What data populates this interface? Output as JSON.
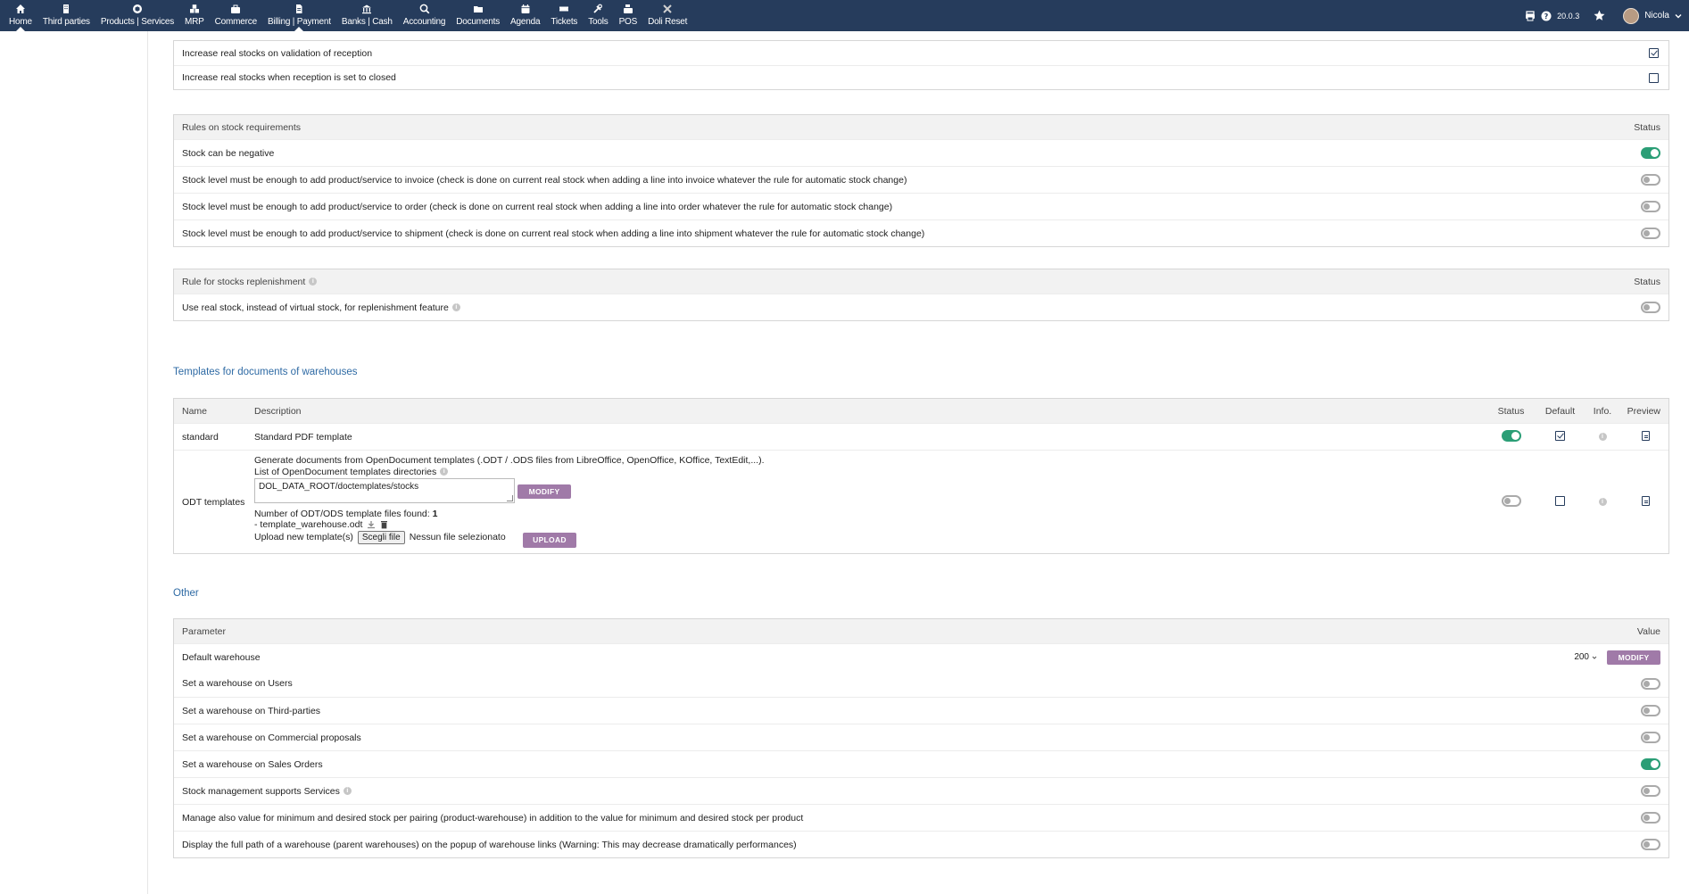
{
  "menu": [
    {
      "label": "Home",
      "icon": "home-icon",
      "active": true
    },
    {
      "label": "Third parties",
      "icon": "building-icon"
    },
    {
      "label": "Products | Services",
      "icon": "cube-icon"
    },
    {
      "label": "MRP",
      "icon": "cubes-icon"
    },
    {
      "label": "Commerce",
      "icon": "suitcase-icon"
    },
    {
      "label": "Billing | Payment",
      "icon": "invoice-icon",
      "active": true
    },
    {
      "label": "Banks | Cash",
      "icon": "bank-icon"
    },
    {
      "label": "Accounting",
      "icon": "search-dollar-icon"
    },
    {
      "label": "Documents",
      "icon": "folder-icon"
    },
    {
      "label": "Agenda",
      "icon": "calendar-icon"
    },
    {
      "label": "Tickets",
      "icon": "ticket-icon"
    },
    {
      "label": "Tools",
      "icon": "tools-icon"
    },
    {
      "label": "POS",
      "icon": "cash-register-icon"
    },
    {
      "label": "Doli Reset",
      "icon": "reset-icon"
    }
  ],
  "topright": {
    "version": "20.0.3",
    "user": "Nicola"
  },
  "reception": {
    "rows": [
      {
        "label": "Increase real stocks on validation of reception",
        "checked": true
      },
      {
        "label": "Increase real stocks when reception is set to closed",
        "checked": false
      }
    ]
  },
  "stock_rules": {
    "header": "Rules on stock requirements",
    "status_header": "Status",
    "rows": [
      {
        "label": "Stock can be negative",
        "on": true
      },
      {
        "label": "Stock level must be enough to add product/service to invoice (check is done on current real stock when adding a line into invoice whatever the rule for automatic stock change)",
        "on": false
      },
      {
        "label": "Stock level must be enough to add product/service to order (check is done on current real stock when adding a line into order whatever the rule for automatic stock change)",
        "on": false
      },
      {
        "label": "Stock level must be enough to add product/service to shipment (check is done on current real stock when adding a line into shipment whatever the rule for automatic stock change)",
        "on": false
      }
    ]
  },
  "replenishment": {
    "header": "Rule for stocks replenishment",
    "status_header": "Status",
    "rows": [
      {
        "label": "Use real stock, instead of virtual stock, for replenishment feature",
        "on": false
      }
    ]
  },
  "templates": {
    "title": "Templates for documents of warehouses",
    "headers": {
      "name": "Name",
      "description": "Description",
      "status": "Status",
      "default": "Default",
      "info": "Info.",
      "preview": "Preview"
    },
    "standard": {
      "name": "standard",
      "description": "Standard PDF template"
    },
    "odt": {
      "name": "ODT templates",
      "line1": "Generate documents from OpenDocument templates (.ODT / .ODS files from LibreOffice, OpenOffice, KOffice, TextEdit,...).",
      "line2": "List of OpenDocument templates directories",
      "dir_value": "DOL_DATA_ROOT/doctemplates/stocks",
      "modify_label": "MODIFY",
      "found_label": "Number of ODT/ODS template files found:",
      "found_count": "1",
      "file": "- template_warehouse.odt",
      "upload_label": "Upload new template(s)",
      "choose_file": "Scegli file",
      "no_file": "Nessun file selezionato",
      "upload_button": "UPLOAD"
    }
  },
  "other": {
    "title": "Other",
    "param_header": "Parameter",
    "value_header": "Value",
    "default_warehouse": {
      "label": "Default warehouse",
      "value": "200",
      "button": "MODIFY"
    },
    "rows": [
      {
        "label": "Set a warehouse on Users",
        "on": false
      },
      {
        "label": "Set a warehouse on Third-parties",
        "on": false
      },
      {
        "label": "Set a warehouse on Commercial proposals",
        "on": false
      },
      {
        "label": "Set a warehouse on Sales Orders",
        "on": true
      },
      {
        "label": "Stock management supports Services",
        "on": false,
        "info": true
      },
      {
        "label": "Manage also value for minimum and desired stock per pairing (product-warehouse) in addition to the value for minimum and desired stock per product",
        "on": false
      },
      {
        "label": "Display the full path of a warehouse (parent warehouses) on the popup of warehouse links (Warning: This may decrease dramatically performances)",
        "on": false
      }
    ]
  },
  "colors": {
    "topbar": "#263c5c",
    "toggle_on": "#2b9e76",
    "button": "#a07aa8",
    "section_title": "#2e6aa4"
  }
}
